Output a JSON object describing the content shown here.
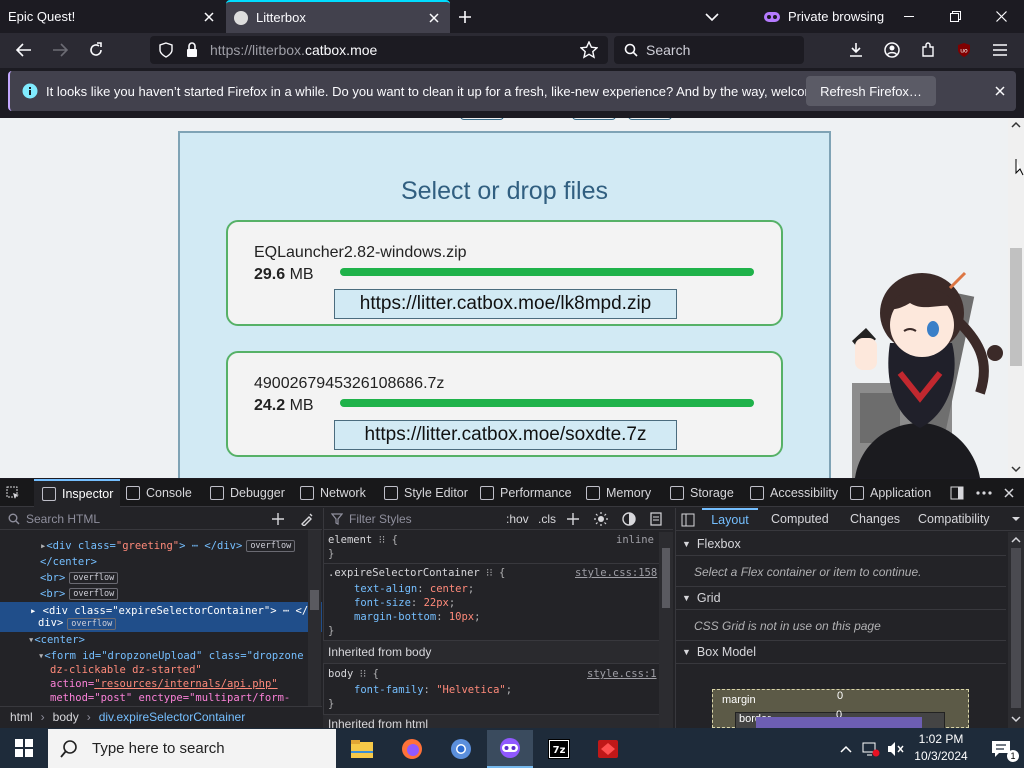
{
  "tabs": [
    {
      "title": "Epic Quest!"
    },
    {
      "title": "Litterbox"
    }
  ],
  "private": {
    "label": "Private browsing"
  },
  "url": {
    "prefix": "https://litterbox.",
    "domain": "catbox.moe"
  },
  "search": {
    "placeholder": "Search"
  },
  "notification": {
    "message": "It looks like you haven’t started Firefox in a while. Do you want to clean it up for a fresh, like-new experience? And by the way, welcome back!",
    "button": "Refresh Firefox…"
  },
  "page": {
    "dropzone_title": "Select or drop files",
    "files": [
      {
        "name": "EQLauncher2.82-windows.zip",
        "size_value": "29.6",
        "size_unit": "MB",
        "progress": 100,
        "link": "https://litter.catbox.moe/lk8mpd.zip"
      },
      {
        "name": "4900267945326108686.7z",
        "size_value": "24.2",
        "size_unit": "MB",
        "progress": 100,
        "link": "https://litter.catbox.moe/soxdte.7z"
      }
    ]
  },
  "devtools": {
    "tabs": [
      "Inspector",
      "Console",
      "Debugger",
      "Network",
      "Style Editor",
      "Performance",
      "Memory",
      "Storage",
      "Accessibility",
      "Application"
    ],
    "search_placeholder": "Search HTML",
    "filter_placeholder": "Filter Styles",
    "hov": ":hov",
    "cls": ".cls",
    "markup": {
      "line1_tag": "<div class=",
      "line1_val": "\"greeting\"",
      "line1_end": "> ⋯ </div>",
      "center_close": "</center>",
      "br": "<br>",
      "selected_tag": "<div class=",
      "selected_val": "\"expireSelectorContainer\"",
      "selected_end": "> ⋯ </",
      "selected_div": "div>",
      "center_open": "<center>",
      "form_line1": "<form id=\"dropzoneUpload\" class=\"dropzone",
      "form_line2": "dz-clickable dz-started\"",
      "form_line3_attr": "action=",
      "form_line3_val": "\"resources/internals/api.php\"",
      "form_line4": "method=\"post\" enctype=\"multipart/form-",
      "overflow": "overflow"
    },
    "breadcrumbs": [
      "html",
      "body",
      "div.expireSelectorContainer"
    ],
    "rules": {
      "element_selector": "element",
      "element_brace": "{",
      "element_close": "}",
      "inline": "inline",
      "expire_selector": ".expireSelectorContainer",
      "expire_source": "style.css:158",
      "decls": [
        {
          "prop": "text-align",
          "val": "center"
        },
        {
          "prop": "font-size",
          "val": "22px"
        },
        {
          "prop": "margin-bottom",
          "val": "10px"
        }
      ],
      "inherited_body": "Inherited from body",
      "body_selector": "body",
      "body_source": "style.css:1",
      "body_decl_prop": "font-family",
      "body_decl_val": "\"Helvetica\"",
      "inherited_html": "Inherited from html"
    },
    "layout_tabs": [
      "Layout",
      "Computed",
      "Changes",
      "Compatibility"
    ],
    "sections": [
      {
        "title": "Flexbox",
        "message": "Select a Flex container or item to continue."
      },
      {
        "title": "Grid",
        "message": "CSS Grid is not in use on this page"
      },
      {
        "title": "Box Model",
        "message": ""
      }
    ],
    "boxmodel": {
      "margin": "margin",
      "margin_value": "0",
      "border": "border",
      "border_value": "0"
    }
  },
  "taskbar": {
    "search_placeholder": "Type here to search",
    "time": "1:02 PM",
    "date": "10/3/2024"
  },
  "colors": {
    "accent": "#0df",
    "progress": "#1fb24a",
    "file_border": "#56b167"
  }
}
